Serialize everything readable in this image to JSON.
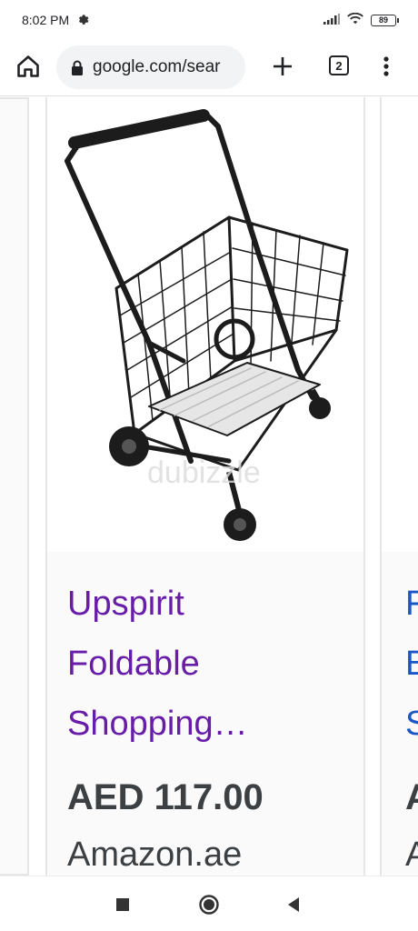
{
  "status_bar": {
    "time": "8:02 PM",
    "battery": "89"
  },
  "toolbar": {
    "url": "google.com/sear",
    "tab_count": "2"
  },
  "product_card": {
    "image_watermark": "dubizzle",
    "title_lines": [
      "Upspirit",
      "Foldable",
      "Shopping…"
    ],
    "price": "AED 117.00",
    "merchant": "Amazon.ae"
  },
  "next_card": {
    "title_peek": [
      "F",
      "B",
      "S"
    ],
    "price_peek": "A",
    "merchant_peek": "A"
  },
  "colors": {
    "visited_link": "#681da8",
    "link": "#1a56c4",
    "text": "#3c4043"
  }
}
